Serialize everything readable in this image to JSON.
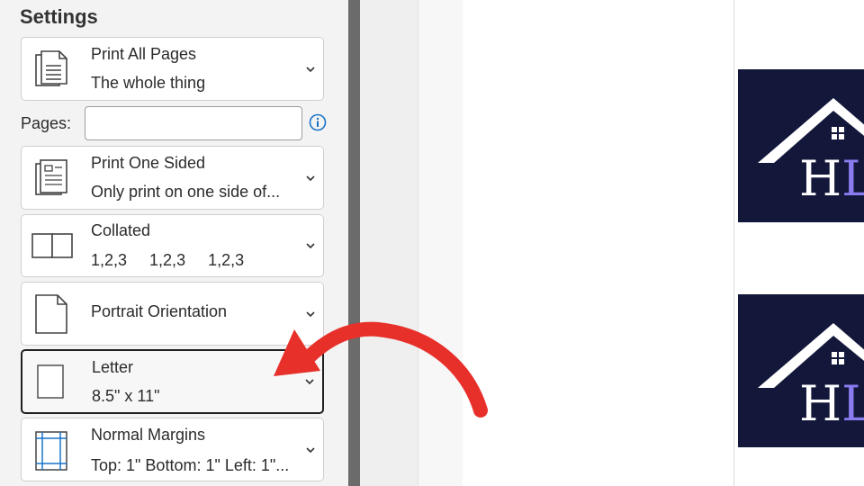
{
  "settings": {
    "title": "Settings",
    "print_range": {
      "line1": "Print All Pages",
      "line2": "The whole thing"
    },
    "pages": {
      "label": "Pages:",
      "value": "",
      "placeholder": ""
    },
    "sides": {
      "line1": "Print One Sided",
      "line2": "Only print on one side of..."
    },
    "collation": {
      "line1": "Collated",
      "line2": "1,2,3     1,2,3     1,2,3"
    },
    "orientation": {
      "line1": "Portrait Orientation"
    },
    "paper_size": {
      "line1": "Letter",
      "line2": "8.5\" x 11\""
    },
    "margins": {
      "line1": "Normal Margins",
      "line2": "Top: 1\" Bottom: 1\" Left: 1\"..."
    }
  },
  "preview": {
    "logo_text_a": "H",
    "logo_text_b": "L"
  },
  "colors": {
    "accent": "#1a73c8",
    "arrow": "#e8302b",
    "logo_bg": "#13183a",
    "logo_letter": "#ffffff",
    "logo_letter_accent": "#8a7cf0"
  }
}
